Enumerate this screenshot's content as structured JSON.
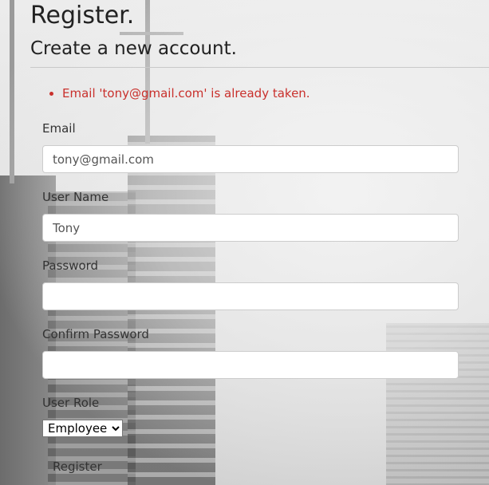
{
  "page": {
    "title": "Register.",
    "subtitle": "Create a new account."
  },
  "errors": [
    "Email 'tony@gmail.com' is already taken."
  ],
  "form": {
    "email": {
      "label": "Email",
      "value": "tony@gmail.com"
    },
    "username": {
      "label": "User Name",
      "value": "Tony"
    },
    "password": {
      "label": "Password",
      "value": ""
    },
    "confirm_password": {
      "label": "Confirm Password",
      "value": ""
    },
    "role": {
      "label": "User Role",
      "selected": "Employee"
    },
    "submit_label": "Register"
  },
  "colors": {
    "error": "#c9302c"
  }
}
